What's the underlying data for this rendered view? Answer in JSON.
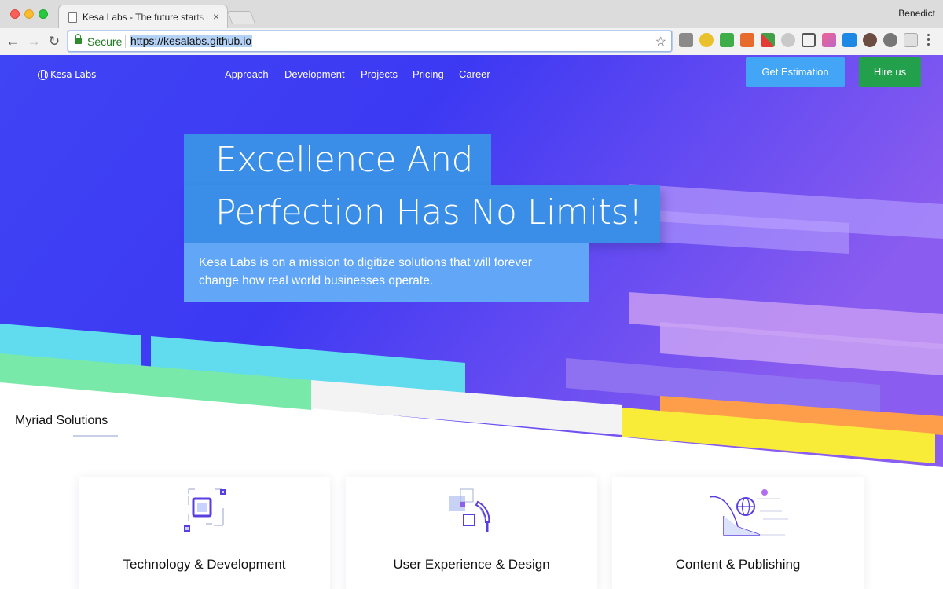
{
  "browser": {
    "tab_title": "Kesa Labs - The future starts now",
    "tab_close": "×",
    "profile_name": "Benedict",
    "secure_label": "Secure",
    "url": "https://kesalabs.github.io",
    "icons": {
      "back": "back-arrow-icon",
      "forward": "forward-arrow-icon",
      "reload": "reload-icon",
      "star": "star-icon"
    }
  },
  "site": {
    "logo_text": "Kesa Labs",
    "nav": [
      "Approach",
      "Development",
      "Projects",
      "Pricing",
      "Career"
    ],
    "cta_estimate": "Get Estimation",
    "cta_hire": "Hire us"
  },
  "hero": {
    "headline_line1": "Excellence And",
    "headline_line2": "Perfection Has No Limits!",
    "tagline": "Kesa Labs is on a mission to digitize solutions that will forever change how real world businesses operate."
  },
  "solutions": {
    "title": "Myriad Solutions",
    "cards": [
      {
        "title": "Technology & Development",
        "icon": "chip-icon"
      },
      {
        "title": "User Experience & Design",
        "icon": "pen-tool-icon"
      },
      {
        "title": "Content & Publishing",
        "icon": "globe-chart-icon"
      }
    ]
  },
  "colors": {
    "hero_start": "#3d39f3",
    "hero_end": "#8a5cf0",
    "headline_box": "#3a8ee8",
    "tagline_box": "#62a7f7",
    "estimate_button": "#42a5f5",
    "hire_button": "#22a04b"
  }
}
